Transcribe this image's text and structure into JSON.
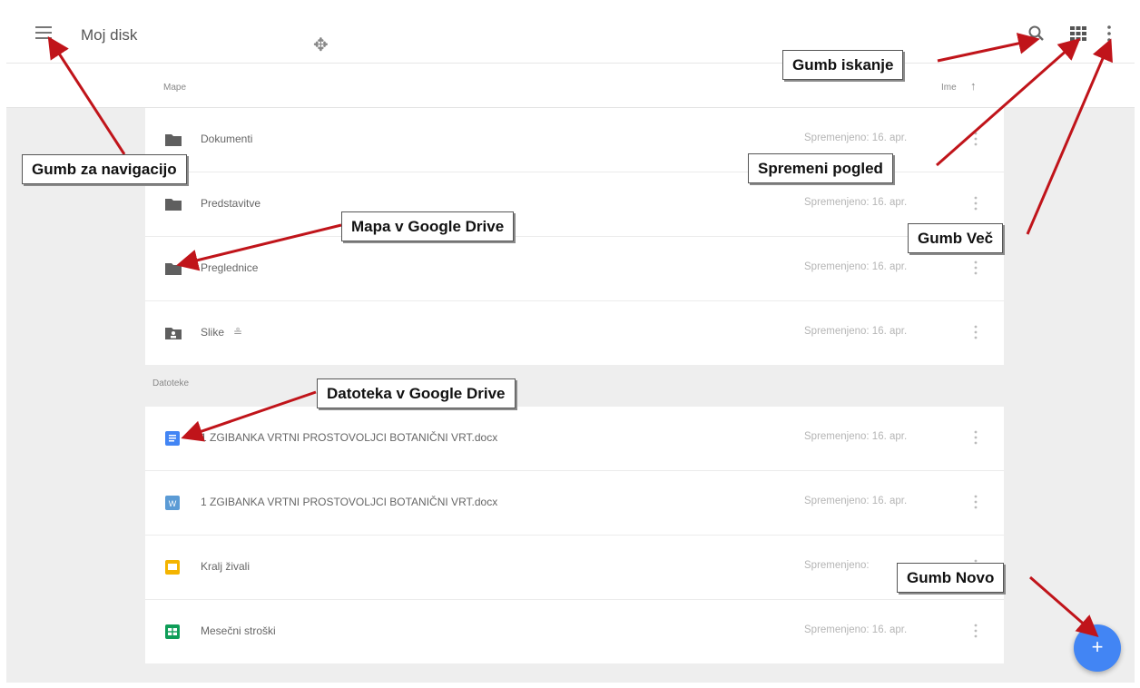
{
  "header": {
    "title": "Moj disk"
  },
  "folders_section": {
    "label": "Mape",
    "sort_label": "Ime",
    "sort_arrow": "↑"
  },
  "folders": [
    {
      "name": "Dokumenti",
      "modified": "Spremenjeno: 16. apr.",
      "icon": "folder-icon"
    },
    {
      "name": "Predstavitve",
      "modified": "Spremenjeno: 16. apr.",
      "icon": "folder-icon"
    },
    {
      "name": "Preglednice",
      "modified": "Spremenjeno: 16. apr.",
      "icon": "folder-icon"
    },
    {
      "name": "Slike",
      "shared": "≗",
      "modified": "Spremenjeno: 16. apr.",
      "icon": "shared-folder-icon"
    }
  ],
  "files_section": {
    "label": "Datoteke"
  },
  "files": [
    {
      "name": "1 ZGIBANKA VRTNI PROSTOVOLJCI BOTANIČNI VRT.docx",
      "modified": "Spremenjeno: 16. apr.",
      "icon": "google-doc-icon",
      "color": "#4285f4"
    },
    {
      "name": "1 ZGIBANKA VRTNI PROSTOVOLJCI BOTANIČNI VRT.docx",
      "modified": "Spremenjeno: 16. apr.",
      "icon": "word-icon",
      "color": "#5b9bd5"
    },
    {
      "name": "Kralj živali",
      "modified": "Spremenjeno:",
      "icon": "google-slides-icon",
      "color": "#f4b400"
    },
    {
      "name": "Mesečni stroški",
      "modified": "Spremenjeno: 16. apr.",
      "icon": "google-sheets-icon",
      "color": "#0f9d58"
    }
  ],
  "fab": {
    "label": "+",
    "color": "#4285f4"
  },
  "callouts": {
    "navigation": "Gumb za navigacijo",
    "search": "Gumb iskanje",
    "view": "Spremeni pogled",
    "more": "Gumb Več",
    "folder": "Mapa v Google Drive",
    "file": "Datoteka v Google Drive",
    "new": "Gumb Novo"
  },
  "colors": {
    "arrow": "#c0141a",
    "folder": "#5f5f5f"
  }
}
